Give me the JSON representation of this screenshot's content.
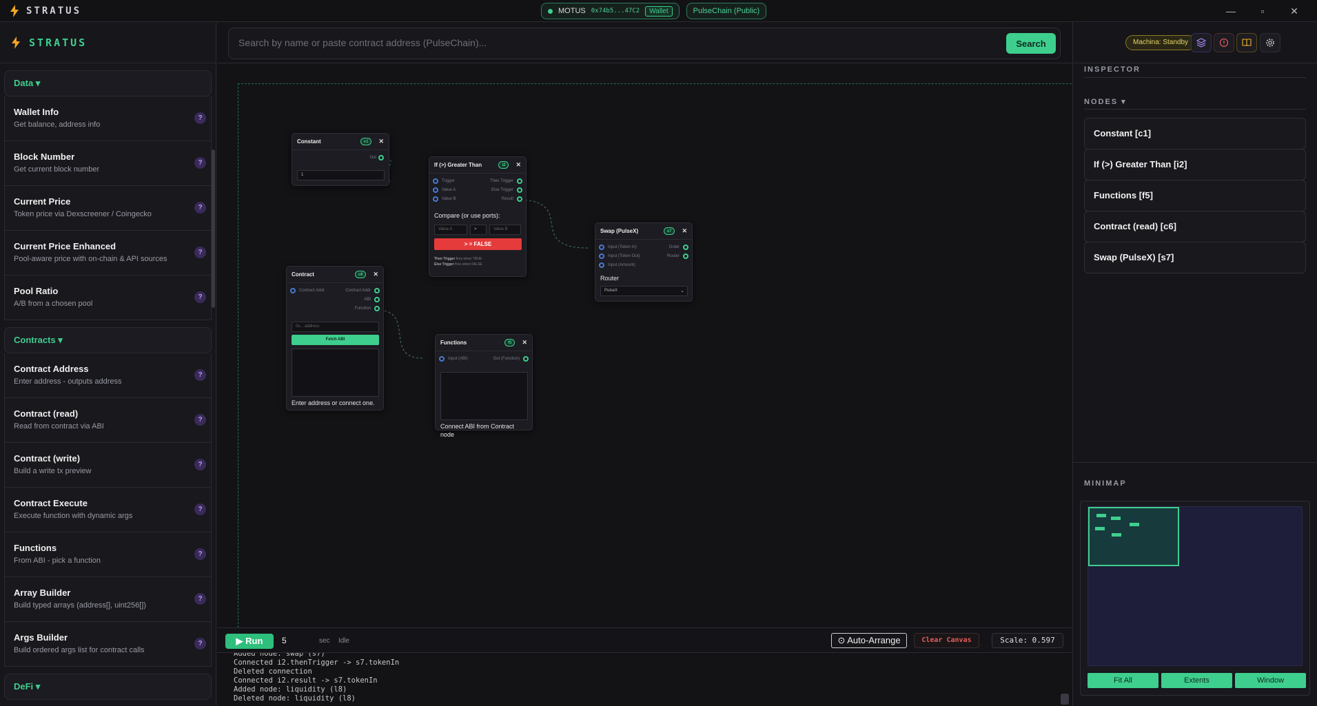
{
  "app": {
    "name": "STRATUS"
  },
  "titlebar": {
    "user": "MOTUS",
    "address": "0x74b5...47C2",
    "wallet_tag": "Wallet",
    "network": "PulseChain (Public)",
    "min": "—",
    "max": "▫",
    "close": "✕"
  },
  "sidebar": {
    "categories": [
      {
        "label": "Data ▾"
      },
      {
        "label": "Contracts ▾"
      },
      {
        "label": "DeFi ▾"
      }
    ],
    "data_items": [
      {
        "title": "Wallet Info",
        "desc": "Get balance, address info"
      },
      {
        "title": "Block Number",
        "desc": "Get current block number"
      },
      {
        "title": "Current Price",
        "desc": "Token price via Dexscreener / Coingecko"
      },
      {
        "title": "Current Price Enhanced",
        "desc": "Pool-aware price with on-chain & API sources"
      },
      {
        "title": "Pool Ratio",
        "desc": "A/B from a chosen pool"
      }
    ],
    "contract_items": [
      {
        "title": "Contract Address",
        "desc": "Enter address - outputs address"
      },
      {
        "title": "Contract (read)",
        "desc": "Read from contract via ABI"
      },
      {
        "title": "Contract (write)",
        "desc": "Build a write tx preview"
      },
      {
        "title": "Contract Execute",
        "desc": "Execute function with dynamic args"
      },
      {
        "title": "Functions",
        "desc": "From ABI - pick a function"
      },
      {
        "title": "Array Builder",
        "desc": "Build typed arrays (address[], uint256[])"
      },
      {
        "title": "Args Builder",
        "desc": "Build ordered args list for contract calls"
      }
    ],
    "help": "?"
  },
  "search": {
    "placeholder": "Search by name or paste contract address (PulseChain)...",
    "button": "Search"
  },
  "nodes": {
    "constant": {
      "title": "Constant",
      "id": "c1",
      "out": "Out",
      "value": "1"
    },
    "greater": {
      "title": "If (>) Greater Than",
      "id": "i2",
      "in_trigger": "Trigger",
      "in_a": "Value A",
      "in_b": "Value B",
      "out_then": "Then Trigger",
      "out_else": "Else Trigger",
      "out_result": "Result",
      "compare_label": "Compare (or use ports):",
      "ph_a": "Value A",
      "op": ">",
      "ph_b": "Value B",
      "result": "> = FALSE",
      "then_note_b": "Then Trigger",
      "then_note": "fires when TRUE",
      "else_note_b": "Else Trigger",
      "else_note": "fires when FALSE"
    },
    "swap": {
      "title": "Swap (PulseX)",
      "id": "s7",
      "in_token_in": "Input (Token In)",
      "in_token_out": "Input (Token Out)",
      "in_amount": "Input (Amount)",
      "out_order": "Order",
      "out_router": "Router",
      "router_label": "Router",
      "router_value": "PulseX"
    },
    "contract": {
      "title": "Contract",
      "id": "c6",
      "in_addr": "Contract Addr",
      "out_addr": "Contract Addr",
      "out_abi": "ABI",
      "out_function": "Function",
      "addr_placeholder": "0x... address",
      "fetch": "Fetch ABI",
      "hint": "Enter address or connect one."
    },
    "functions": {
      "title": "Functions",
      "id": "f5",
      "in_abi": "Input (ABI)",
      "out_function": "Out (Function)",
      "hint": "Connect ABI from Contract node"
    }
  },
  "runbar": {
    "run": "▶ Run",
    "interval": "5",
    "sec": "sec",
    "status": "Idle",
    "arrange": "⊙ Auto-Arrange",
    "clear": "Clear Canvas",
    "scale": "Scale: 0.597"
  },
  "log": [
    "Added node: swap (s7)",
    "Connected i2.thenTrigger -> s7.tokenIn",
    "Deleted connection",
    "Connected i2.result -> s7.tokenIn",
    "Added node: liquidity (l8)",
    "Deleted node: liquidity (l8)"
  ],
  "rightpanel": {
    "machina": "Machina: Standby",
    "inspector": "INSPECTOR",
    "nodes_label": "NODES ▾",
    "node_list": [
      "Constant [c1]",
      "If (>) Greater Than [i2]",
      "Functions [f5]",
      "Contract (read) [c6]",
      "Swap (PulseX) [s7]"
    ],
    "minimap": "MINIMAP",
    "mm_buttons": [
      "Fit All",
      "Extents",
      "Window"
    ]
  },
  "colors": {
    "accent": "#3ecf8e",
    "danger": "#e53b3b",
    "help": "#b59be6"
  }
}
